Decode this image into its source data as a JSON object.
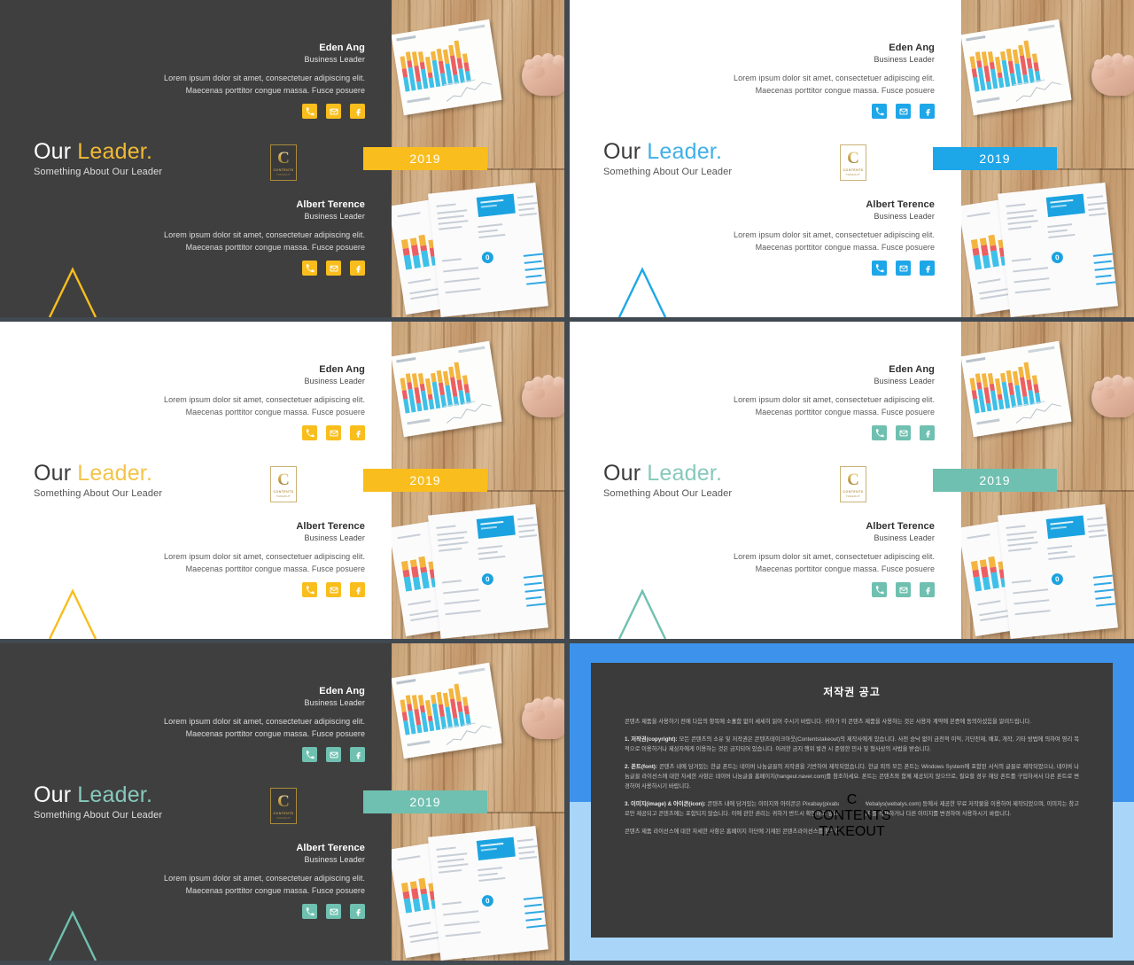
{
  "theme": {
    "dark_bg": "#3f3f3f",
    "light_bg": "#ffffff",
    "gutter": "#414951",
    "yellow": "#f9be1d",
    "blue": "#1ea7e8",
    "teal": "#6fc0b0",
    "copyright_blue": "#3d93ec",
    "copyright_blue_light": "#a9d6f8",
    "logo_gold": "#c9a44e"
  },
  "common": {
    "title_word1": "Our",
    "title_word2": "Leader.",
    "subtitle": "Something About Our Leader",
    "year_badge": "2019",
    "logo": {
      "letter": "C",
      "word1": "CONTENTS",
      "word2": "TAKEOUT"
    },
    "people": [
      {
        "name": "Eden Ang",
        "role": "Business Leader",
        "body": "Lorem ipsum dolor sit amet, consectetuer adipiscing elit. Maecenas porttitor congue massa. Fusce posuere",
        "socials": [
          "phone-icon",
          "mail-icon",
          "facebook-icon"
        ]
      },
      {
        "name": "Albert Terence",
        "role": "Business Leader",
        "body": "Lorem ipsum dolor sit amet, consectetuer adipiscing elit. Maecenas porttitor congue massa. Fusce posuere",
        "socials": [
          "phone-icon",
          "mail-icon",
          "facebook-icon"
        ]
      }
    ]
  },
  "slides": [
    {
      "id": "slide-dark-yellow",
      "mode": "dark",
      "accent": "#f9be1d",
      "title2_color": "#f0ba35"
    },
    {
      "id": "slide-light-blue",
      "mode": "light",
      "accent": "#1ea7e8",
      "title2_color": "#3fb0e8"
    },
    {
      "id": "slide-light-yellow",
      "mode": "light",
      "accent": "#f9be1d",
      "title2_color": "#f3c44a"
    },
    {
      "id": "slide-light-teal",
      "mode": "light",
      "accent": "#6fc0b0",
      "title2_color": "#87c9bb"
    },
    {
      "id": "slide-dark-teal",
      "mode": "dark",
      "accent": "#6fc0b0",
      "title2_color": "#87c9bb"
    }
  ],
  "copyright": {
    "title": "저작권 공고",
    "intro": "콘텐츠 제품을 사용하기 전에 다음의 항목에 소홀함 없이 세세히 읽어 주시기 바랍니다. 귀하가 이 콘텐츠 제품을 사용하는 것은 사용자 계약에 본증에 동의하셨음을 알려드립니다.",
    "sections": [
      {
        "label": "1. 저작권(copyright):",
        "text": " 모든 콘텐츠의 소유 및 저작권은 콘텐츠테이크아웃(Contentstakeout)의 제작사에게 있습니다. 사전 승낙 없이 금전적 이익, 기단전재, 배포, 개작, 기타 방법에 의하여 영리 목적으로 이용하거나 제삼자에게 이용하는 것은 금지되어 있습니다. 이러한 금지 행위 발견 시 준엄한 민사 및 형사상의 사법을 받습니다."
      },
      {
        "label": "2. 폰트(font):",
        "text": " 콘텐츠 내에 담겨있는 한글 폰트는 네이버 나눔글꼴의 저작권을 기반하여 제작되었습니다. 한글 외의 모든 폰트는 Windows System에 포함된 서식의 글꼴로 제작되었으나, 네이버 나눔글꼴 라이선스에 대한 자세한 사항은 네이버 나눔글꼴 홈페이지(hangeul.naver.com)를 참조하세요. 폰트는 콘텐츠와 함께 제공되지 않으므로, 필요할 경우 해당 폰트를 구입하셔서 다른 폰트로 변경하여 사용하시기 바랍니다."
      },
      {
        "label": "3. 이미지(image) & 아이콘(icon):",
        "text": " 콘텐츠 내에 담겨있는 이미지와 아이콘은 Pixabay(pixabay.com)와 Webalys(webalys.com) 등에서 제공한 무료 저작물을 이용하여 제작되었으며, 이미지는 참고로만 제공되고 콘텐츠에는 포함되지 않습니다. 이에 관한 권리는 귀하가 반드시 확인하고 필요할 경우 이미지를 삭제하거나 다른 이미지를 변경하여 사용하시기 바랍니다."
      }
    ],
    "footer": "콘텐츠 제품 라이선스에 대한 자세한 사항은 홈페이지 하단에 기재된 콘텐츠라이선스를 참조하세요."
  }
}
